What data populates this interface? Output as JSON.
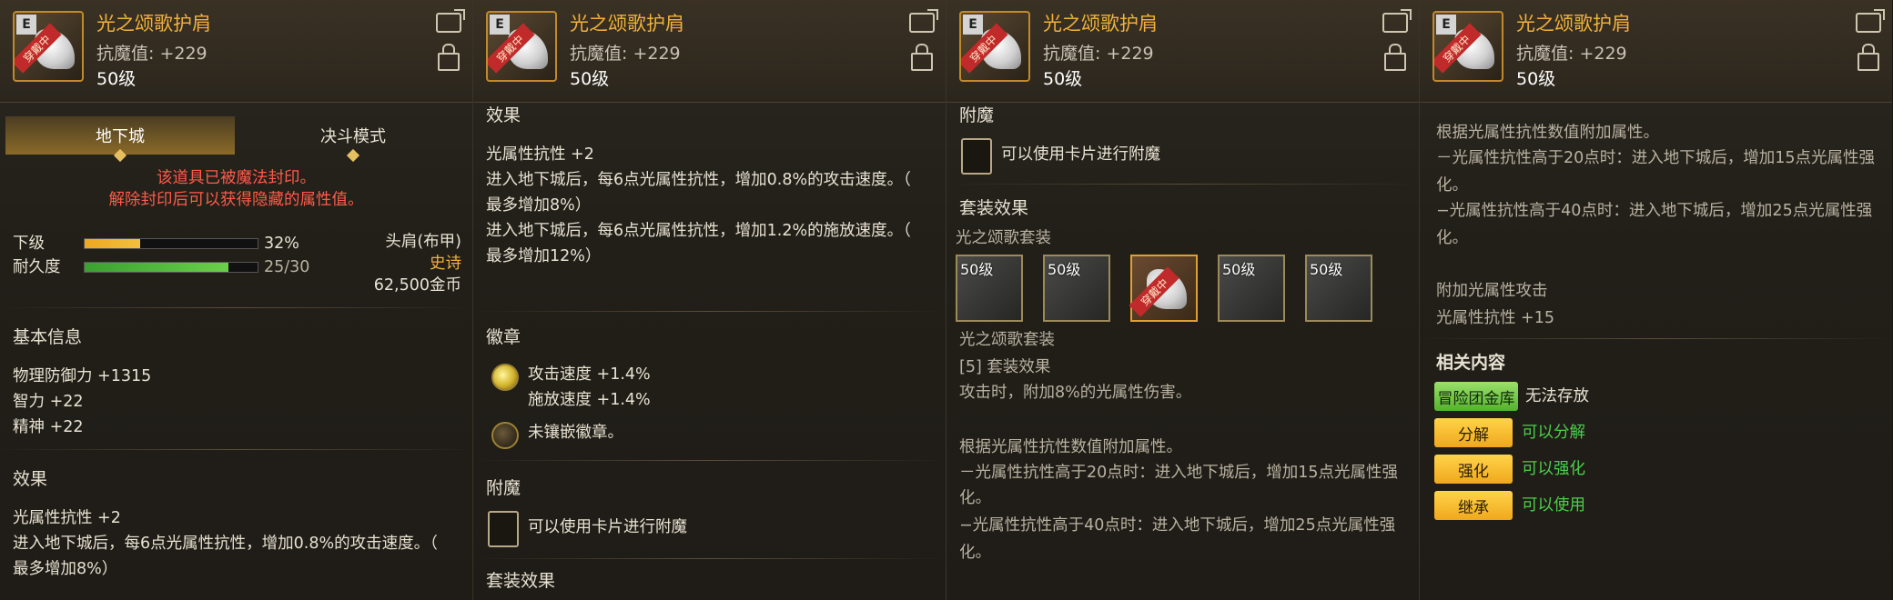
{
  "item": {
    "name": "光之颂歌护肩",
    "sub": "抗魔值: +229",
    "level": "50级",
    "icon_tag": "E",
    "icon_ribbon": "穿戴中"
  },
  "p1": {
    "tab_dungeon": "地下城",
    "tab_pvp": "决斗模式",
    "seal_line1": "该道具已被魔法封印。",
    "seal_line2": "解除封印后可以获得隐藏的属性值。",
    "grade_label": "下级",
    "grade_pct": "32%",
    "grade_value": 0.32,
    "dura_label": "耐久度",
    "dura_value": "25/30",
    "dura_fraction": 0.833,
    "slot": "头肩(布甲)",
    "rarity": "史诗",
    "price": "62,500金币",
    "basic_title": "基本信息",
    "basic": [
      "物理防御力 +1315",
      "智力 +22",
      "精神 +22"
    ],
    "effect_title": "效果",
    "effect": [
      "光属性抗性 +2",
      "进入地下城后，每6点光属性抗性，增加0.8%的攻击速度。（",
      "最多增加8%）"
    ]
  },
  "p2": {
    "effect_title": "效果",
    "effect": [
      "光属性抗性 +2",
      "进入地下城后，每6点光属性抗性，增加0.8%的攻击速度。（",
      "最多增加8%）",
      "进入地下城后，每6点光属性抗性，增加1.2%的施放速度。（",
      "最多增加12%）"
    ],
    "emblem_title": "徽章",
    "emblem1": [
      "攻击速度 +1.4%",
      "施放速度 +1.4%"
    ],
    "emblem2": "未镶嵌徽章。",
    "enchant_title": "附魔",
    "enchant_text": "可以使用卡片进行附魔",
    "set_title": "套装效果"
  },
  "p3": {
    "enchant_title": "附魔",
    "enchant_text": "可以使用卡片进行附魔",
    "set_title": "套装效果",
    "set_name": "光之颂歌套装",
    "set_items": [
      "50级",
      "50级",
      "50级",
      "50级"
    ],
    "set_name2": "光之颂歌套装",
    "set_bonus": "[5] 套装效果",
    "set_line1": "攻击时，附加8%的光属性伤害。",
    "set_desc": [
      "根据光属性抗性数值附加属性。",
      "－光属性抗性高于20点时：进入地下城后，增加15点光属性强",
      "化。",
      "−光属性抗性高于40点时：进入地下城后，增加25点光属性强",
      "化。"
    ]
  },
  "p4": {
    "desc": [
      "根据光属性抗性数值附加属性。",
      "－光属性抗性高于20点时：进入地下城后，增加15点光属性强",
      "化。",
      "−光属性抗性高于40点时：进入地下城后，增加25点光属性强",
      "化。"
    ],
    "extra_title": "附加光属性攻击",
    "extra_value": "光属性抗性 +15",
    "related_title": "相关内容",
    "rows": [
      {
        "btn": "冒险团金库",
        "text": "无法存放"
      },
      {
        "btn": "分解",
        "text": "可以分解"
      },
      {
        "btn": "强化",
        "text": "可以强化"
      },
      {
        "btn": "继承",
        "text": "可以使用"
      }
    ]
  }
}
